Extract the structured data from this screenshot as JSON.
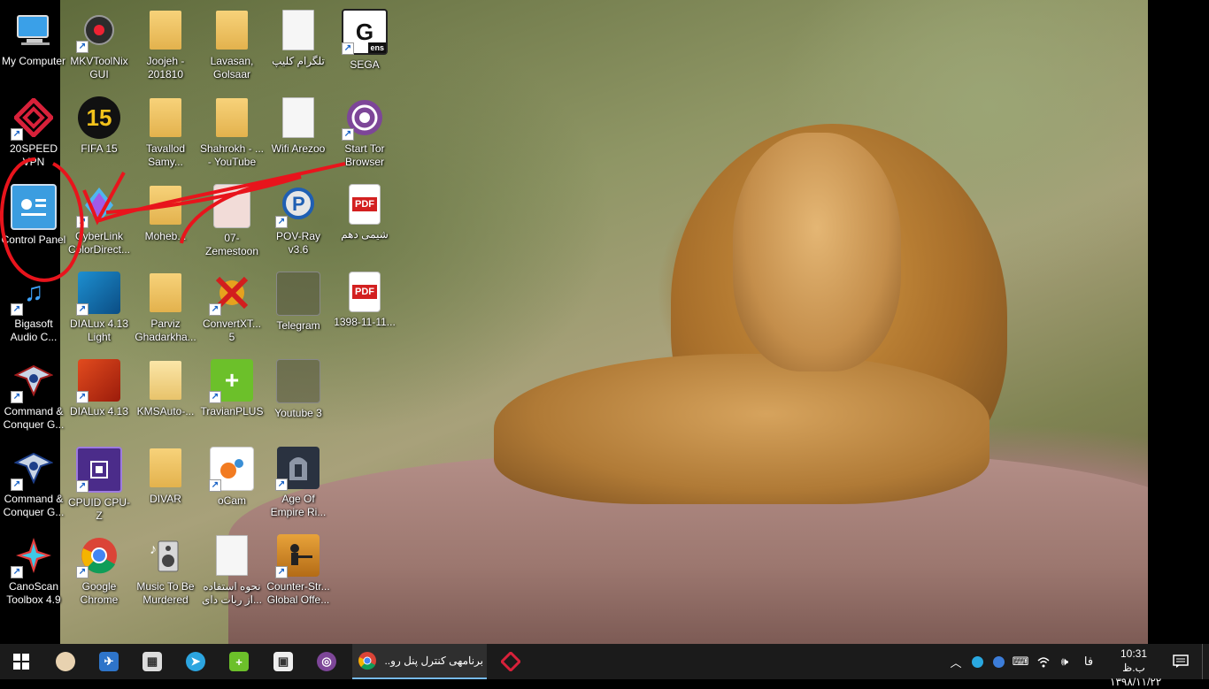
{
  "desktop": {
    "icons": [
      {
        "label": "My Computer"
      },
      {
        "label": "20SPEED VPN"
      },
      {
        "label": "Control Panel"
      },
      {
        "label": "Bigasoft Audio C..."
      },
      {
        "label": "Command & Conquer G..."
      },
      {
        "label": "Command & Conquer G..."
      },
      {
        "label": "CanoScan Toolbox 4.9"
      },
      {
        "label": "MKVToolNix GUI"
      },
      {
        "label": "FIFA 15"
      },
      {
        "label": "CyberLink ColorDirect..."
      },
      {
        "label": "DIALux 4.13 Light"
      },
      {
        "label": "DIALux 4.13"
      },
      {
        "label": "CPUID CPU-Z"
      },
      {
        "label": "Google Chrome"
      },
      {
        "label": "Joojeh - 201810"
      },
      {
        "label": "Tavallod Samy..."
      },
      {
        "label": "Moheb..."
      },
      {
        "label": "Parviz Ghadarkha..."
      },
      {
        "label": "KMSAuto-..."
      },
      {
        "label": "DIVAR"
      },
      {
        "label": "Music To Be Murdered"
      },
      {
        "label": "Lavasan, Golsaar"
      },
      {
        "label": "Shahrokh - ... - YouTube"
      },
      {
        "label": "07- Zemestoon"
      },
      {
        "label": "ConvertXT... 5"
      },
      {
        "label": "TravianPLUS"
      },
      {
        "label": "oCam"
      },
      {
        "label": "نحوه استفاده از ربات دای..."
      },
      {
        "label": "تلگرام کلیپ"
      },
      {
        "label": "Wifi Arezoo"
      },
      {
        "label": "POV-Ray v3.6"
      },
      {
        "label": "Telegram"
      },
      {
        "label": "Youtube 3"
      },
      {
        "label": "Age Of Empire Ri..."
      },
      {
        "label": "Counter-Str... Global Offe..."
      },
      {
        "label": "SEGA"
      },
      {
        "label": "Start Tor Browser"
      },
      {
        "label": "شیمی دهم"
      },
      {
        "label": "1398-11-11..."
      }
    ],
    "icon_glyphs": {
      "ens": "ens",
      "fifa": "15",
      "pdf": "PDF"
    }
  },
  "taskbar": {
    "chrome_window_title": "برنامهی کنترل پنل رو...",
    "language": "فا",
    "time": "10:31 ب.ظ",
    "date": "۱۳۹۸/۱۱/۲۲"
  },
  "colors": {
    "taskbar_bg": "#1b1b1b",
    "active_underline": "#76b9ed",
    "annotation_red": "#e8141c"
  }
}
